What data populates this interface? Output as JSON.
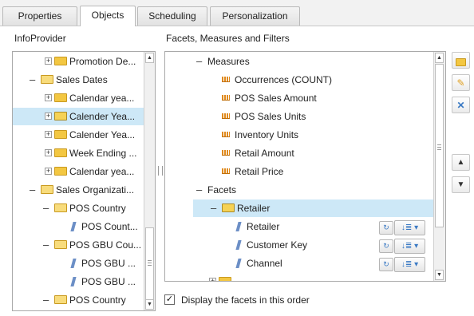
{
  "tabs": [
    {
      "label": "Properties"
    },
    {
      "label": "Objects"
    },
    {
      "label": "Scheduling"
    },
    {
      "label": "Personalization"
    }
  ],
  "left_panel": {
    "title": "InfoProvider",
    "items": [
      {
        "label": "Promotion De..."
      },
      {
        "label": "Sales Dates"
      },
      {
        "label": "Calendar yea..."
      },
      {
        "label": "Calender Yea..."
      },
      {
        "label": "Calender Yea..."
      },
      {
        "label": "Week Ending ..."
      },
      {
        "label": "Calendar yea..."
      },
      {
        "label": "Sales Organizati..."
      },
      {
        "label": "POS Country"
      },
      {
        "label": "POS Count..."
      },
      {
        "label": "POS GBU Cou..."
      },
      {
        "label": "POS GBU ..."
      },
      {
        "label": "POS GBU ..."
      },
      {
        "label": "POS Country"
      }
    ]
  },
  "right_panel": {
    "title": "Facets, Measures and Filters",
    "measures_label": "Measures",
    "measures": [
      {
        "label": "Occurrences (COUNT)"
      },
      {
        "label": "POS Sales Amount"
      },
      {
        "label": "POS Sales Units"
      },
      {
        "label": "Inventory Units"
      },
      {
        "label": "Retail Amount"
      },
      {
        "label": "Retail Price"
      }
    ],
    "facets_label": "Facets",
    "facet_group": {
      "label": "Retailer"
    },
    "facets": [
      {
        "label": "Retailer"
      },
      {
        "label": "Customer Key"
      },
      {
        "label": "Channel"
      }
    ]
  },
  "footer": {
    "checkbox_label": "Display the facets in this order",
    "checked": true
  },
  "icons": {
    "move_right": "arrow-right-icon",
    "move_left": "arrow-left-icon",
    "move_up": "arrow-up-icon",
    "move_down": "arrow-down-icon",
    "new_folder": "folder-icon",
    "rename": "pencil-icon",
    "delete": "close-icon",
    "check": "✓"
  },
  "colors": {
    "selection": "#cde8f7",
    "accent": "#3b7ac4"
  }
}
